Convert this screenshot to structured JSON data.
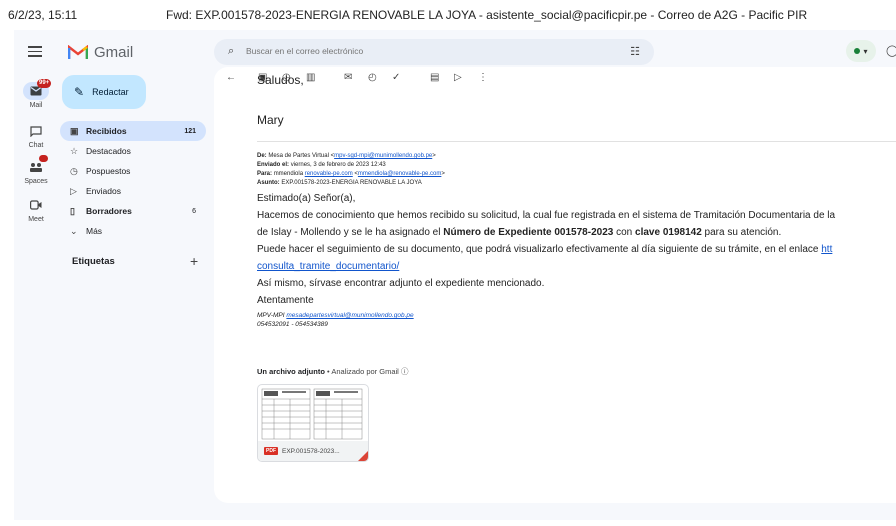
{
  "print_header": {
    "datetime": "6/2/23, 15:11",
    "title": "Fwd: EXP.001578-2023-ENERGIA RENOVABLE LA JOYA - asistente_social@pacificpir.pe - Correo de A2G - Pacific PIR"
  },
  "app": {
    "name": "Gmail",
    "compose_label": "Redactar",
    "search_placeholder": "Buscar en el correo electrónico"
  },
  "rail": [
    {
      "label": "Mail",
      "icon": "mail-icon",
      "badge": "99+"
    },
    {
      "label": "Chat",
      "icon": "chat-icon"
    },
    {
      "label": "Spaces",
      "icon": "spaces-icon"
    },
    {
      "label": "Meet",
      "icon": "meet-icon"
    }
  ],
  "nav": [
    {
      "label": "Recibidos",
      "icon": "inbox-icon",
      "count": "121"
    },
    {
      "label": "Destacados",
      "icon": "star-icon",
      "count": ""
    },
    {
      "label": "Pospuestos",
      "icon": "clock-icon",
      "count": ""
    },
    {
      "label": "Enviados",
      "icon": "send-icon",
      "count": ""
    },
    {
      "label": "Borradores",
      "icon": "draft-icon",
      "count": "6"
    },
    {
      "label": "Más",
      "icon": "chevron-down-icon",
      "count": ""
    }
  ],
  "labels_heading": "Etiquetas",
  "email": {
    "greeting_tail": "Saludos,",
    "sender_sign": "Mary",
    "forward_header": {
      "de_label": "De:",
      "de_value": "Mesa de Partes Virtual <",
      "de_link": "mpv-sgd-mpi@munimollendo.gob.pe",
      "de_end": ">",
      "enviado_label": "Enviado el:",
      "enviado_value": "viernes, 3 de febrero de 2023 12:43",
      "para_label": "Para:",
      "para_value": "mmendiola ",
      "para_link1": "renovable-pe.com",
      "para_mid": " <",
      "para_link2": "mmendiola@renovable-pe.com",
      "para_end": ">",
      "asunto_label": "Asunto:",
      "asunto_value": "EXP.001578-2023-ENERGIA RENOVABLE LA JOYA"
    },
    "salutation": "Estimado(a) Señor(a),",
    "line1": "Hacemos de conocimiento que hemos recibido su solicitud, la cual fue registrada en el sistema de Tramitación Documentaria de la",
    "line2_a": "de Islay - Mollendo y se le ha asignado el ",
    "line2_b": "Número de Expediente 001578-2023",
    "line2_c": "  con ",
    "line2_d": "clave 0198142",
    "line2_e": " para su atención.",
    "line3_a": "Puede hacer el seguimiento de su documento, que podrá visualizarlo efectivamente al día siguiente de su trámite, en el enlace ",
    "line3_link": "htt",
    "line4_link": "consulta_tramite_documentario/",
    "line5": "Así mismo, sírvase encontrar adjunto el expediente mencionado.",
    "line6": "Atentamente",
    "sig1_a": "MPV-MPI ",
    "sig1_link": "mesadepartesvirtual@munimollendo.gob.pe",
    "sig2": "054532091 - 054534389"
  },
  "attachment": {
    "heading": "Un archivo adjunto",
    "sep": " • ",
    "scan": "Analizado por Gmail",
    "info_icon": "ⓘ",
    "file_type": "PDF",
    "file_name": "EXP.001578-2023..."
  }
}
